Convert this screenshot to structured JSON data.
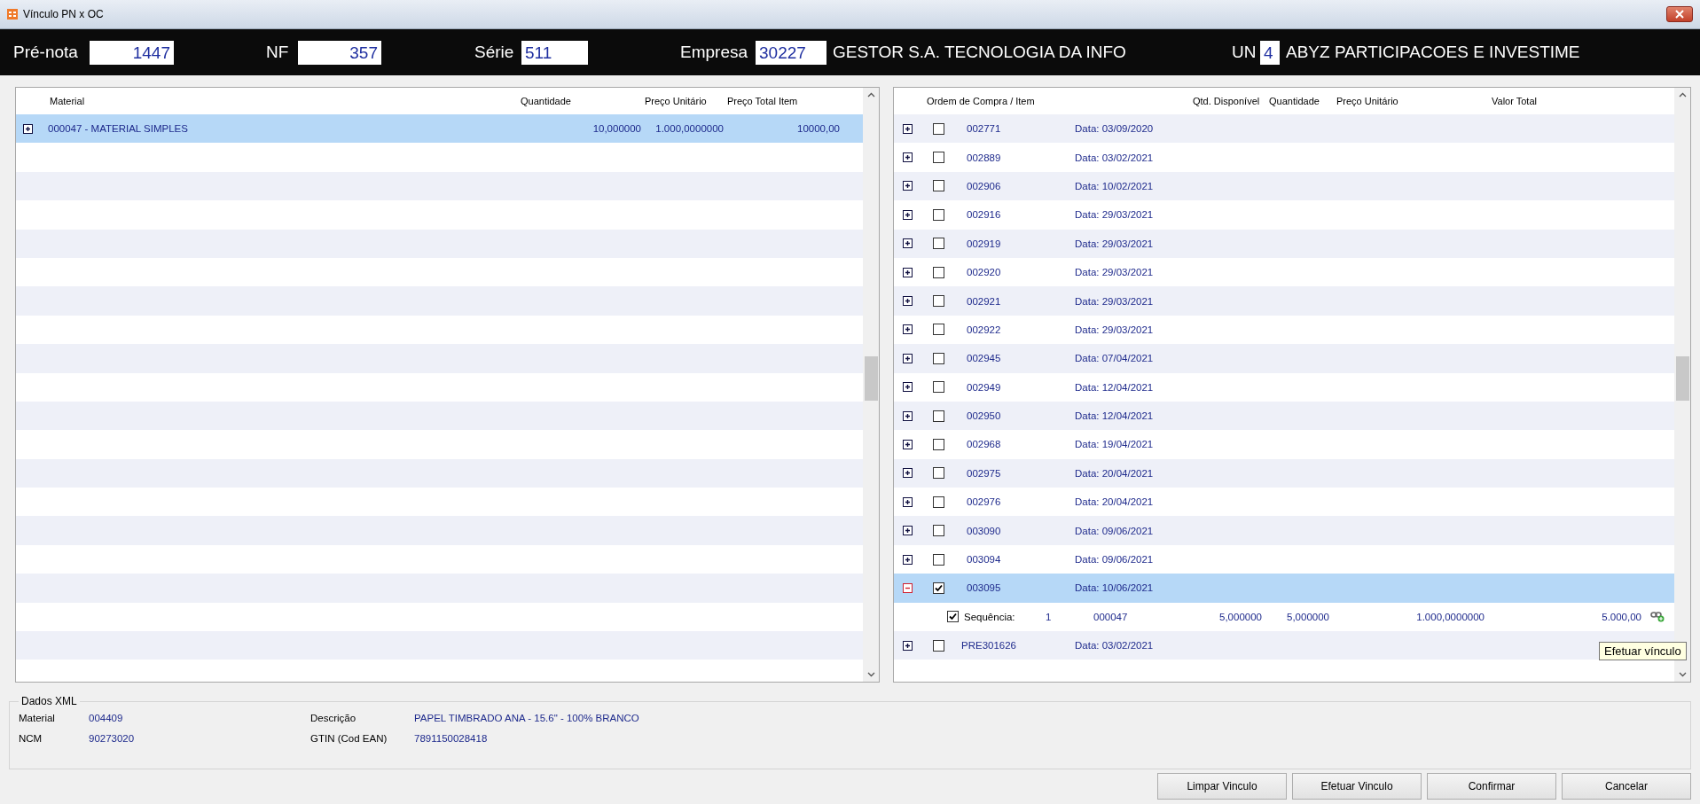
{
  "window": {
    "title": "Vínculo PN x OC"
  },
  "header": [
    {
      "label": "Pré-nota",
      "value": "1447",
      "kind": "numeric"
    },
    {
      "label": "NF",
      "value": "357",
      "kind": "numeric"
    },
    {
      "label": "Série",
      "value": "511",
      "kind": "code"
    },
    {
      "label": "Empresa",
      "value": "30227",
      "kind": "code",
      "name": "GESTOR S.A. TECNOLOGIA DA INFO"
    },
    {
      "label": "UN",
      "value": "4",
      "kind": "code",
      "name": "ABYZ PARTICIPACOES E INVESTIME"
    }
  ],
  "materials": {
    "columns": [
      "Material",
      "Quantidade",
      "Preço Unitário",
      "Preço Total Item"
    ],
    "rows": [
      {
        "material": "000047 - MATERIAL SIMPLES",
        "quantity": "10,000000",
        "unit_price": "1.000,0000000",
        "total": "10000,00",
        "selected": true,
        "expanded": false
      }
    ]
  },
  "orders": {
    "columns": [
      "Ordem de Compra / Item",
      "Qtd. Disponível",
      "Quantidade",
      "Preço Unitário",
      "Valor Total"
    ],
    "rows": [
      {
        "code": "002771",
        "date": "Data: 03/09/2020",
        "checked": false,
        "expanded": false,
        "selected": false
      },
      {
        "code": "002889",
        "date": "Data: 03/02/2021",
        "checked": false,
        "expanded": false,
        "selected": false
      },
      {
        "code": "002906",
        "date": "Data: 10/02/2021",
        "checked": false,
        "expanded": false,
        "selected": false
      },
      {
        "code": "002916",
        "date": "Data: 29/03/2021",
        "checked": false,
        "expanded": false,
        "selected": false
      },
      {
        "code": "002919",
        "date": "Data: 29/03/2021",
        "checked": false,
        "expanded": false,
        "selected": false
      },
      {
        "code": "002920",
        "date": "Data: 29/03/2021",
        "checked": false,
        "expanded": false,
        "selected": false
      },
      {
        "code": "002921",
        "date": "Data: 29/03/2021",
        "checked": false,
        "expanded": false,
        "selected": false
      },
      {
        "code": "002922",
        "date": "Data: 29/03/2021",
        "checked": false,
        "expanded": false,
        "selected": false
      },
      {
        "code": "002945",
        "date": "Data: 07/04/2021",
        "checked": false,
        "expanded": false,
        "selected": false
      },
      {
        "code": "002949",
        "date": "Data: 12/04/2021",
        "checked": false,
        "expanded": false,
        "selected": false
      },
      {
        "code": "002950",
        "date": "Data: 12/04/2021",
        "checked": false,
        "expanded": false,
        "selected": false
      },
      {
        "code": "002968",
        "date": "Data: 19/04/2021",
        "checked": false,
        "expanded": false,
        "selected": false
      },
      {
        "code": "002975",
        "date": "Data: 20/04/2021",
        "checked": false,
        "expanded": false,
        "selected": false
      },
      {
        "code": "002976",
        "date": "Data: 20/04/2021",
        "checked": false,
        "expanded": false,
        "selected": false
      },
      {
        "code": "003090",
        "date": "Data: 09/06/2021",
        "checked": false,
        "expanded": false,
        "selected": false
      },
      {
        "code": "003094",
        "date": "Data: 09/06/2021",
        "checked": false,
        "expanded": false,
        "selected": false
      },
      {
        "code": "003095",
        "date": "Data: 10/06/2021",
        "checked": true,
        "expanded": true,
        "selected": true,
        "children": [
          {
            "label": "Sequência:",
            "sequence": "1",
            "material": "000047",
            "available": "5,000000",
            "quantity": "5,000000",
            "unit_price": "1.000,0000000",
            "total": "5.000,00",
            "checked": true
          }
        ]
      },
      {
        "code": "PRE301626",
        "date": "Data: 03/02/2021",
        "checked": false,
        "expanded": false,
        "selected": false
      }
    ]
  },
  "tooltip": "Efetuar vínculo",
  "xml": {
    "title": "Dados XML",
    "fields": [
      {
        "label": "Material",
        "value": "004409"
      },
      {
        "label": "Descrição",
        "value": "PAPEL TIMBRADO ANA - 15.6\" - 100% BRANCO"
      },
      {
        "label": "NCM",
        "value": "90273020"
      },
      {
        "label": "GTIN (Cod EAN)",
        "value": "7891150028418"
      }
    ]
  },
  "buttons": [
    "Limpar Vinculo",
    "Efetuar Vinculo",
    "Confirmar",
    "Cancelar"
  ]
}
